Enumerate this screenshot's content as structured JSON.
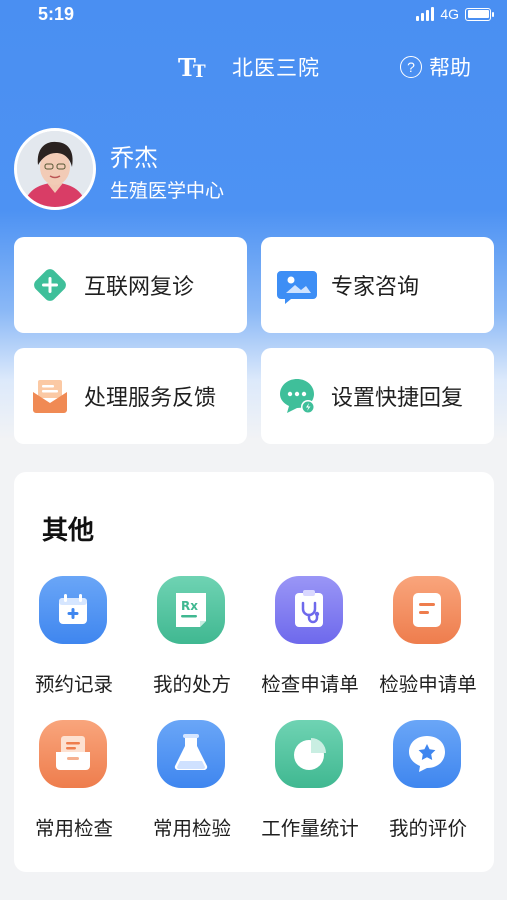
{
  "status_bar": {
    "time": "5:19",
    "network": "4G"
  },
  "nav": {
    "title": "北医三院",
    "help_label": "帮助",
    "font_toggle_glyph": "TT"
  },
  "profile": {
    "name": "乔杰",
    "department": "生殖医学中心"
  },
  "quick_actions": [
    {
      "label": "互联网复诊",
      "icon": "plus-diamond-icon",
      "color": "#3fbf9a"
    },
    {
      "label": "专家咨询",
      "icon": "image-chat-icon",
      "color": "#3d8ef5"
    },
    {
      "label": "处理服务反馈",
      "icon": "envelope-icon",
      "color": "#f08a54"
    },
    {
      "label": "设置快捷回复",
      "icon": "chat-bolt-icon",
      "color": "#3fbf9a"
    }
  ],
  "others": {
    "title": "其他",
    "items": [
      {
        "label": "预约记录",
        "icon": "calendar-plus-icon",
        "color": "#4a8ff2"
      },
      {
        "label": "我的处方",
        "icon": "prescription-icon",
        "color": "#4ec3a0"
      },
      {
        "label": "检查申请单",
        "icon": "stethoscope-clipboard-icon",
        "color": "#7d79f0"
      },
      {
        "label": "检验申请单",
        "icon": "form-icon",
        "color": "#f2875a"
      },
      {
        "label": "常用检查",
        "icon": "tray-icon",
        "color": "#f2875a"
      },
      {
        "label": "常用检验",
        "icon": "flask-icon",
        "color": "#4a8ff2"
      },
      {
        "label": "工作量统计",
        "icon": "pie-chart-icon",
        "color": "#4ec3a0"
      },
      {
        "label": "我的评价",
        "icon": "star-chat-icon",
        "color": "#4a8ff2"
      }
    ]
  }
}
